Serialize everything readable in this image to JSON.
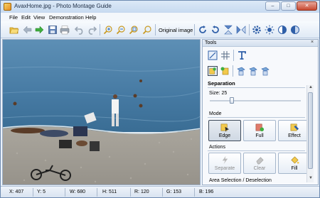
{
  "window": {
    "title": "AvaxHome.jpg - Photo Montage Guide",
    "controls": {
      "minimize": "‒",
      "maximize": "□",
      "close": "✕"
    }
  },
  "menu": [
    "File",
    "Edit",
    "View",
    "Demonstration",
    "Help"
  ],
  "toolbar": {
    "original_image_label": "Original image",
    "icons": [
      "open-folder-icon",
      "back-arrow-icon",
      "forward-arrow-icon",
      "save-icon",
      "print-icon",
      "undo-icon",
      "redo-icon",
      "zoom-in-icon",
      "zoom-out-icon",
      "zoom-fit-icon",
      "zoom-actual-icon",
      "rotate-left-icon",
      "rotate-right-icon",
      "flip-vertical-icon",
      "flip-horizontal-icon",
      "settings-gear-icon",
      "brightness-icon",
      "contrast-icon",
      "saturation-icon"
    ]
  },
  "tools": {
    "title": "Tools",
    "close": "×",
    "separation": {
      "title": "Separation",
      "size_label": "Size: 25",
      "size_value": 25
    },
    "mode": {
      "title": "Mode",
      "buttons": [
        {
          "label": "Edge",
          "active": true
        },
        {
          "label": "Full",
          "active": false
        },
        {
          "label": "Effect",
          "active": false
        }
      ]
    },
    "actions": {
      "title": "Actions",
      "buttons": [
        {
          "label": "Separate",
          "disabled": true
        },
        {
          "label": "Clear",
          "disabled": true
        },
        {
          "label": "Fill",
          "disabled": false
        }
      ]
    },
    "next_section": "Area Selection / Deselection"
  },
  "status": {
    "x": "X: 407",
    "y": "Y: 5",
    "w": "W: 680",
    "h": "H: 511",
    "r": "R: 120",
    "g": "G: 153",
    "b": "B: 196"
  },
  "colors": {
    "accent": "#2f6ebd",
    "sea": "#4a7fa6",
    "sand": "#a19d94"
  }
}
